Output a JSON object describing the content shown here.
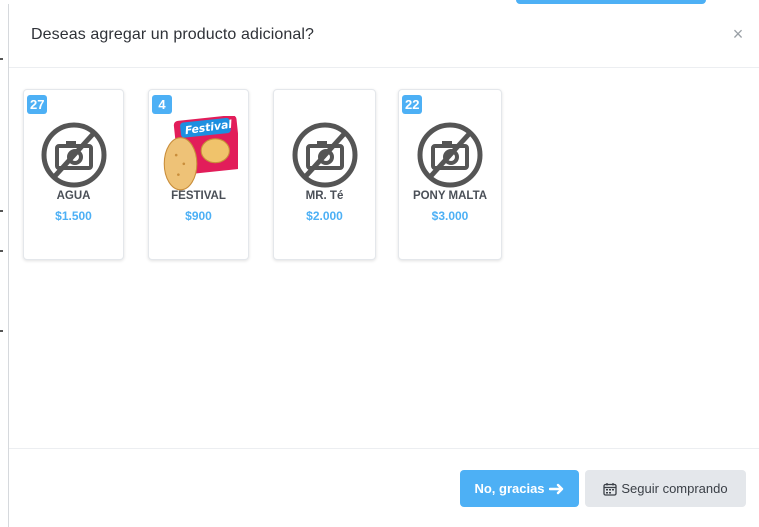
{
  "modal": {
    "title": "Deseas agregar un producto adicional?",
    "close_symbol": "×"
  },
  "products": [
    {
      "name": "AGUA",
      "price": "$1.500",
      "stock": "27",
      "image": "no-image-icon"
    },
    {
      "name": "FESTIVAL",
      "price": "$900",
      "stock": "4",
      "image": "festival-cookie-package",
      "image_text": "Festival"
    },
    {
      "name": "MR. Té",
      "price": "$2.000",
      "stock": "",
      "image": "no-image-icon"
    },
    {
      "name": "PONY MALTA",
      "price": "$3.000",
      "stock": "22",
      "image": "no-image-icon"
    }
  ],
  "footer": {
    "no_thanks_label": "No, gracias",
    "no_thanks_icon": "arrow-right-icon",
    "keep_shopping_label": "Seguir comprando",
    "keep_shopping_icon": "calendar-icon"
  },
  "colors": {
    "accent": "#4db0f5",
    "secondary_button": "#e4e7eb",
    "text": "#2f3238"
  }
}
